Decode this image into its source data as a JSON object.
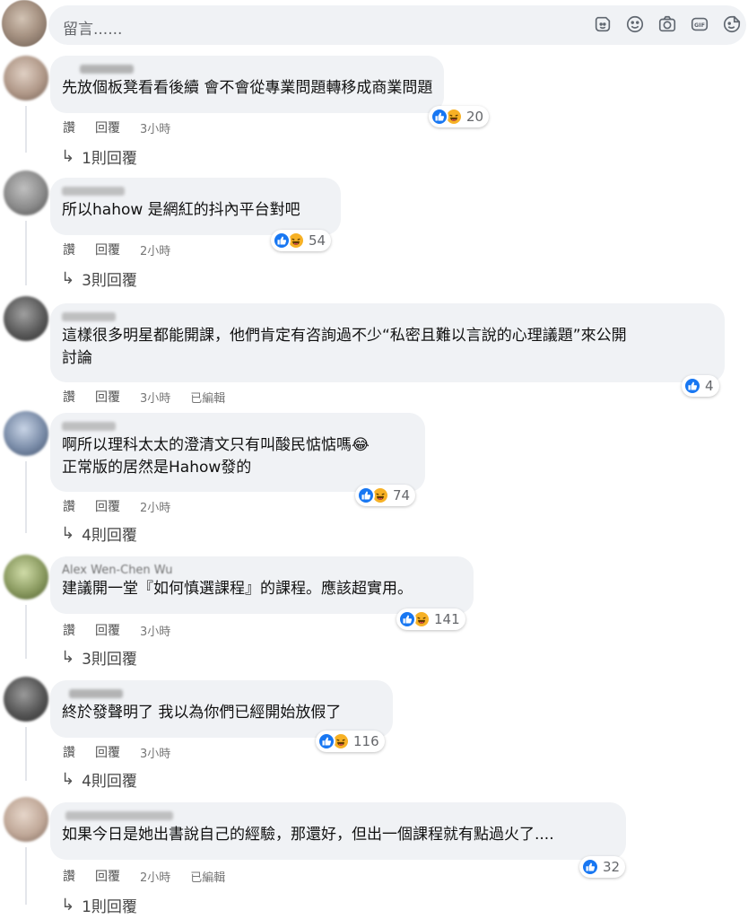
{
  "composer": {
    "placeholder": "留言......",
    "tools": [
      "sticker-icon",
      "emoji-icon",
      "camera-icon",
      "gif-icon",
      "sticker-face-icon"
    ]
  },
  "actions": {
    "like": "讚",
    "reply": "回覆",
    "edited": "已編輯"
  },
  "comments": [
    {
      "author": "",
      "lines": [
        "先放個板凳看看後續 會不會從專業問題轉移成商業問題"
      ],
      "time": "3小時",
      "edited": false,
      "reactions": [
        "like",
        "haha"
      ],
      "reaction_count": "20",
      "replies": "1則回覆",
      "avatar_color": "#b8a090"
    },
    {
      "author": "",
      "lines": [
        "所以hahow 是網紅的抖內平台對吧"
      ],
      "time": "2小時",
      "edited": false,
      "reactions": [
        "like",
        "haha"
      ],
      "reaction_count": "54",
      "replies": "3則回覆",
      "avatar_color": "#8a8a8a"
    },
    {
      "author": "",
      "lines": [
        "這樣很多明星都能開課，他們肯定有咨詢過不少“私密且難以言說的心理議題”來公開",
        "討論"
      ],
      "time": "3小時",
      "edited": true,
      "reactions": [
        "like"
      ],
      "reaction_count": "4",
      "replies": "",
      "avatar_color": "#5a5a5a"
    },
    {
      "author": "",
      "lines": [
        "啊所以理科太太的澄清文只有叫酸民惦惦嗎😂",
        "正常版的居然是Hahow發的"
      ],
      "time": "2小時",
      "edited": false,
      "reactions": [
        "like",
        "haha"
      ],
      "reaction_count": "74",
      "replies": "4則回覆",
      "avatar_color": "#7a8ca8"
    },
    {
      "author": "Alex Wen-Chen Wu",
      "lines": [
        "建議開一堂『如何慎選課程』的課程。應該超實用。"
      ],
      "time": "3小時",
      "edited": false,
      "reactions": [
        "like",
        "haha"
      ],
      "reaction_count": "141",
      "replies": "3則回覆",
      "avatar_color": "#8a9a60"
    },
    {
      "author": "",
      "lines": [
        "終於發聲明了 我以為你們已經開始放假了"
      ],
      "time": "3小時",
      "edited": false,
      "reactions": [
        "like",
        "haha"
      ],
      "reaction_count": "116",
      "replies": "4則回覆",
      "avatar_color": "#555555"
    },
    {
      "author": "",
      "lines": [
        "如果今日是她出書說自己的經驗，那還好，但出一個課程就有點過火了...."
      ],
      "time": "2小時",
      "edited": true,
      "reactions": [
        "like"
      ],
      "reaction_count": "32",
      "replies": "1則回覆",
      "avatar_color": "#c0a898"
    }
  ]
}
